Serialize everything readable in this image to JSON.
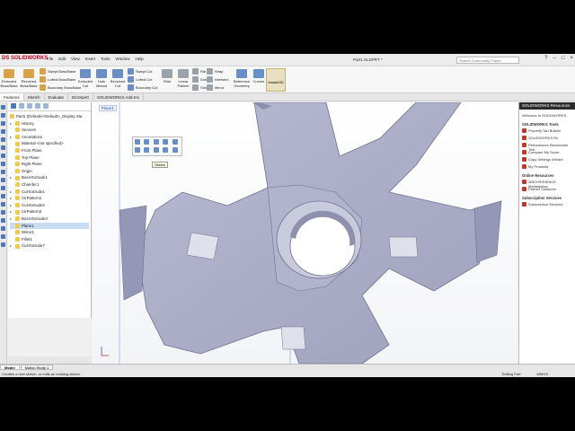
{
  "app": {
    "logo_text": "DS SOLIDWORKS",
    "menus": [
      "File",
      "Edit",
      "View",
      "Insert",
      "Tools",
      "Window",
      "Help"
    ],
    "document_title": "Part1.SLDPRT *",
    "search_placeholder": "Search Community Forum",
    "window_buttons": [
      "?",
      "–",
      "□",
      "×"
    ]
  },
  "ribbon": {
    "extruded_boss": "Extruded Boss/Base",
    "revolved_boss": "Revolved Boss/Base",
    "swept_boss": "Swept Boss/Base",
    "lofted_boss": "Lofted Boss/Base",
    "boundary_boss": "Boundary Boss/Base",
    "extruded_cut": "Extruded Cut",
    "hole_wizard": "Hole Wizard",
    "revolved_cut": "Revolved Cut",
    "swept_cut": "Swept Cut",
    "lofted_cut": "Lofted Cut",
    "boundary_cut": "Boundary Cut",
    "fillet": "Fillet",
    "linear_pattern": "Linear Pattern",
    "rib": "Rib",
    "draft": "Draft",
    "shell": "Shell",
    "wrap": "Wrap",
    "intersect": "Intersect",
    "mirror": "Mirror",
    "reference_geometry": "Reference Geometry",
    "curves": "Curves",
    "instant3d": "Instant3D"
  },
  "tabs": [
    {
      "label": "Features",
      "active": true
    },
    {
      "label": "Sketch",
      "active": false
    },
    {
      "label": "Evaluate",
      "active": false
    },
    {
      "label": "DimXpert",
      "active": false
    },
    {
      "label": "SOLIDWORKS Add-Ins",
      "active": false
    }
  ],
  "feature_tree": {
    "root": "Part1 (Default<<Default>_Display Sta",
    "items": [
      {
        "label": "History",
        "expander": "▸",
        "selected": false
      },
      {
        "label": "Sensors",
        "expander": "",
        "selected": false
      },
      {
        "label": "Annotations",
        "expander": "▸",
        "selected": false
      },
      {
        "label": "Material <not specified>",
        "expander": "",
        "selected": false
      },
      {
        "label": "Front Plane",
        "expander": "",
        "selected": false
      },
      {
        "label": "Top Plane",
        "expander": "",
        "selected": false
      },
      {
        "label": "Right Plane",
        "expander": "",
        "selected": false
      },
      {
        "label": "Origin",
        "expander": "",
        "selected": false
      },
      {
        "label": "Boss-Extrude1",
        "expander": "▸",
        "selected": false
      },
      {
        "label": "Chamfer1",
        "expander": "",
        "selected": false
      },
      {
        "label": "Cut-Extrude1",
        "expander": "▸",
        "selected": false
      },
      {
        "label": "CirPattern1",
        "expander": "▸",
        "selected": false
      },
      {
        "label": "Cut-Extrude2",
        "expander": "▸",
        "selected": false
      },
      {
        "label": "CirPattern2",
        "expander": "▸",
        "selected": false
      },
      {
        "label": "Boss-Extrude3",
        "expander": "▸",
        "selected": false
      },
      {
        "label": "Plane1",
        "expander": "",
        "selected": true
      },
      {
        "label": "Mirror1",
        "expander": "",
        "selected": false
      },
      {
        "label": "Fillet1",
        "expander": "",
        "selected": false
      },
      {
        "label": "Cut-Extrude7",
        "expander": "▸",
        "selected": false
      }
    ]
  },
  "viewport": {
    "plane_tag": "Plane1",
    "tooltip": "Sketch"
  },
  "task_pane": {
    "header": "SOLIDWORKS Resources",
    "welcome": "Welcome to SOLIDWORKS",
    "tools_title": "SOLIDWORKS Tools",
    "tools": [
      "Property Tab Builder",
      "SOLIDWORKS Rx",
      "Performance Benchmark Test",
      "Compare My Score",
      "Copy Settings Wizard",
      "My Products"
    ],
    "online_title": "Online Resources",
    "online": [
      "3DEXPERIENCE Marketplace",
      "Partner Solutions"
    ],
    "subscription_title": "Subscription Services",
    "subscription": [
      "Subscription Services"
    ]
  },
  "status": {
    "model_tabs": [
      "Model",
      "Motion Study 1"
    ],
    "message": "Creates a new sketch, or edits an existing sketch.",
    "mode": "Editing Part",
    "units": "MMGS"
  },
  "colors": {
    "part": "#a9abc6",
    "part_dark": "#7d7f9c",
    "background": "#ffffff"
  }
}
